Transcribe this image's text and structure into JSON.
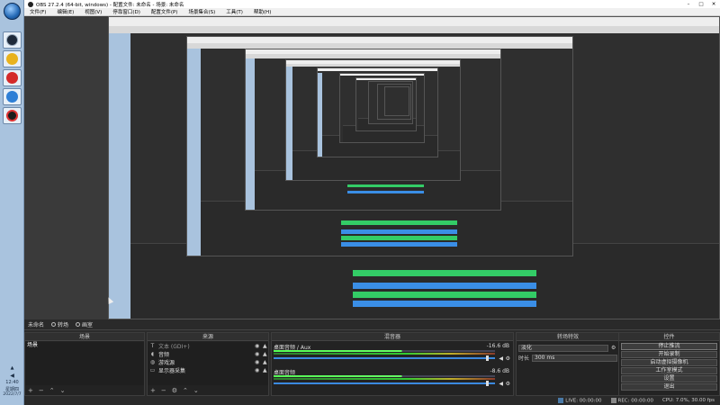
{
  "window": {
    "title": "OBS 27.2.4 (64-bit, windows) - 配置文件: 未命名 - 场景: 未命名",
    "controls": [
      "–",
      "□",
      "✕"
    ]
  },
  "menu": [
    "文件(F)",
    "编辑(E)",
    "视图(V)",
    "停靠窗口(D)",
    "配置文件(P)",
    "场景集合(S)",
    "工具(T)",
    "帮助(H)"
  ],
  "taskbar": {
    "apps": [
      "obs-icon",
      "baidu-icon",
      "netease-music-icon",
      "cloud-icon",
      "record-icon"
    ],
    "time": "12:40",
    "weekday": "星期四",
    "date": "2022/7/7"
  },
  "dockbar": {
    "title": "未命名",
    "scene_transitions": "转场",
    "studio": "画室"
  },
  "scenes": {
    "header": "场景",
    "items": [
      "场景"
    ]
  },
  "sources": {
    "header": "来源",
    "items": [
      {
        "icon": "text-icon",
        "label": "文本 (GDI+)"
      },
      {
        "icon": "audio-icon",
        "label": "音频"
      },
      {
        "icon": "gamepad-icon",
        "label": "游戏源"
      },
      {
        "icon": "display-icon",
        "label": "显示器采集"
      }
    ]
  },
  "mixer": {
    "header": "混音器",
    "channels": [
      {
        "name": "桌面音频 / Aux",
        "db": "-16.6 dB"
      },
      {
        "name": "桌面音频",
        "db": "-8.6 dB"
      }
    ]
  },
  "transitions": {
    "header": "转场特效",
    "type": "淡化",
    "duration_label": "时长",
    "duration": "300 ms"
  },
  "controls": {
    "header": "控件",
    "buttons": [
      "停止推流",
      "开始录制",
      "启动虚拟摄像机",
      "工作室模式",
      "设置",
      "退出"
    ]
  },
  "status": {
    "live": "LIVE:",
    "live_time": "00:00:00",
    "rec": "REC:",
    "rec_time": "00:00:00",
    "cpu": "CPU: 7.0%, 30.00 fps"
  },
  "colors": {
    "accent": "#3b89e0",
    "meter_green": "#33cc33",
    "background": "#2b2b2b"
  }
}
